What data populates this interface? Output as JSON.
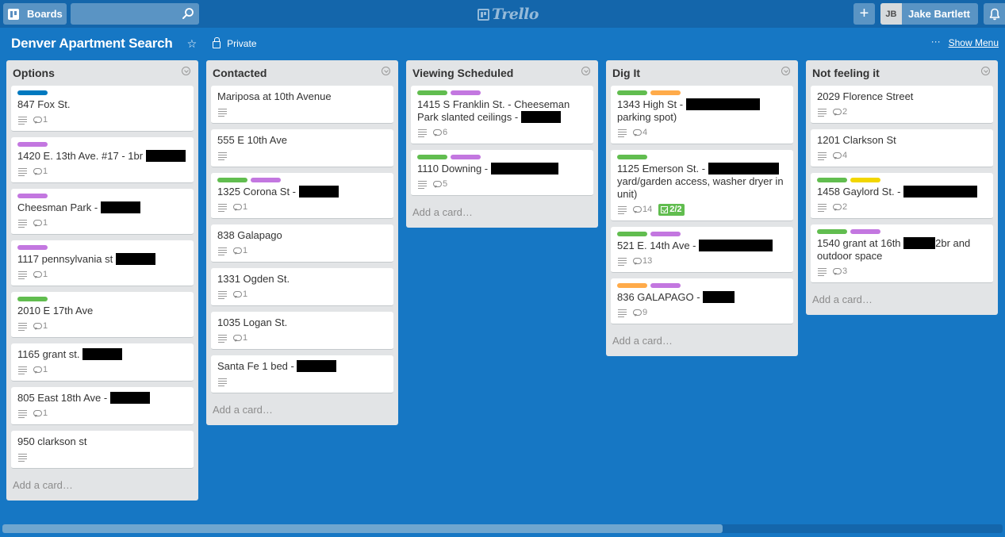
{
  "header": {
    "boards_label": "Boards",
    "search_value": "",
    "search_placeholder": "",
    "logo_text": "Trello",
    "add_label": "+",
    "user": {
      "initials": "JB",
      "name": "Jake Bartlett"
    }
  },
  "board": {
    "title": "Denver Apartment Search",
    "visibility": "Private",
    "more_label": "···",
    "show_menu_label": "Show Menu"
  },
  "colors": {
    "blue": "#0079bf",
    "purple": "#c377e0",
    "green": "#61bd4f",
    "orange": "#ffab4a",
    "yellow": "#f2d600",
    "board_bg": "#1677c4",
    "header_bg": "#1466ab",
    "list_bg": "#e2e4e6"
  },
  "add_card_label": "Add a card…",
  "scroll": {
    "visible_fraction": 0.72
  },
  "lists": [
    {
      "title": "Options",
      "cards": [
        {
          "labels": [
            "blue"
          ],
          "text": "847 Fox St.",
          "redact": [],
          "description": true,
          "comments": "1"
        },
        {
          "labels": [
            "purple"
          ],
          "text": "1420 E. 13th Ave. #17 - 1br ",
          "redact": [
            50
          ],
          "description": true,
          "comments": "1"
        },
        {
          "labels": [
            "purple"
          ],
          "text": "Cheesman Park - ",
          "redact": [
            50
          ],
          "description": true,
          "comments": "1"
        },
        {
          "labels": [
            "purple"
          ],
          "text": "1117 pennsylvania st ",
          "redact": [
            50
          ],
          "description": true,
          "comments": "1"
        },
        {
          "labels": [
            "green"
          ],
          "text": "2010 E 17th Ave",
          "redact": [],
          "description": true,
          "comments": "1"
        },
        {
          "labels": [],
          "text": "1165 grant st. ",
          "redact": [
            50
          ],
          "description": true,
          "comments": "1"
        },
        {
          "labels": [],
          "text": "805 East 18th Ave - ",
          "redact": [
            50
          ],
          "description": true,
          "comments": "1"
        },
        {
          "labels": [],
          "text": "950 clarkson st",
          "redact": [],
          "description": true,
          "comments": null
        }
      ]
    },
    {
      "title": "Contacted",
      "cards": [
        {
          "labels": [],
          "text": "Mariposa at 10th Avenue",
          "redact": [],
          "description": true,
          "comments": null
        },
        {
          "labels": [],
          "text": "555 E 10th Ave",
          "redact": [],
          "description": true,
          "comments": null
        },
        {
          "labels": [
            "green",
            "purple"
          ],
          "text": "1325 Corona St - ",
          "redact": [
            50
          ],
          "description": true,
          "comments": "1"
        },
        {
          "labels": [],
          "text": "838 Galapago",
          "redact": [],
          "description": true,
          "comments": "1"
        },
        {
          "labels": [],
          "text": "1331 Ogden St.",
          "redact": [],
          "description": true,
          "comments": "1"
        },
        {
          "labels": [],
          "text": "1035 Logan St.",
          "redact": [],
          "description": true,
          "comments": "1"
        },
        {
          "labels": [],
          "text": "Santa Fe 1 bed - ",
          "redact": [
            50
          ],
          "description": true,
          "comments": null
        }
      ]
    },
    {
      "title": "Viewing Scheduled",
      "cards": [
        {
          "labels": [
            "green",
            "purple"
          ],
          "text": "1415 S Franklin St. - Cheeseman Park slanted ceilings - ",
          "redact": [
            50
          ],
          "description": true,
          "comments": "6"
        },
        {
          "labels": [
            "green",
            "purple"
          ],
          "text": "1110 Downing - ",
          "redact": [
            85
          ],
          "description": true,
          "comments": "5"
        }
      ]
    },
    {
      "title": "Dig It",
      "cards": [
        {
          "labels": [
            "green",
            "orange"
          ],
          "text": "1343 High St - ",
          "text_after": " parking spot)",
          "redact": [
            93
          ],
          "description": true,
          "comments": "4"
        },
        {
          "labels": [
            "green"
          ],
          "text": "1125 Emerson St. - ",
          "text_after": " yard/garden access, washer dryer in unit)",
          "redact": [
            89
          ],
          "description": true,
          "comments": "14",
          "checklist": "2/2"
        },
        {
          "labels": [
            "green",
            "purple"
          ],
          "text": "521 E. 14th Ave - ",
          "redact": [
            93
          ],
          "description": true,
          "comments": "13"
        },
        {
          "labels": [
            "orange",
            "purple"
          ],
          "text": "836 GALAPAGO - ",
          "redact": [
            40
          ],
          "description": true,
          "comments": "9"
        }
      ]
    },
    {
      "title": "Not feeling it",
      "cards": [
        {
          "labels": [],
          "text": "2029 Florence Street",
          "redact": [],
          "description": true,
          "comments": "2"
        },
        {
          "labels": [],
          "text": "1201 Clarkson St",
          "redact": [],
          "description": true,
          "comments": "4"
        },
        {
          "labels": [
            "green",
            "yellow"
          ],
          "text": "1458 Gaylord St. - ",
          "redact": [
            93
          ],
          "description": true,
          "comments": "2"
        },
        {
          "labels": [
            "green",
            "purple"
          ],
          "text": "1540 grant at 16th ",
          "text_after": "2br and outdoor space",
          "redact": [
            40
          ],
          "description": true,
          "comments": "3"
        }
      ]
    }
  ]
}
